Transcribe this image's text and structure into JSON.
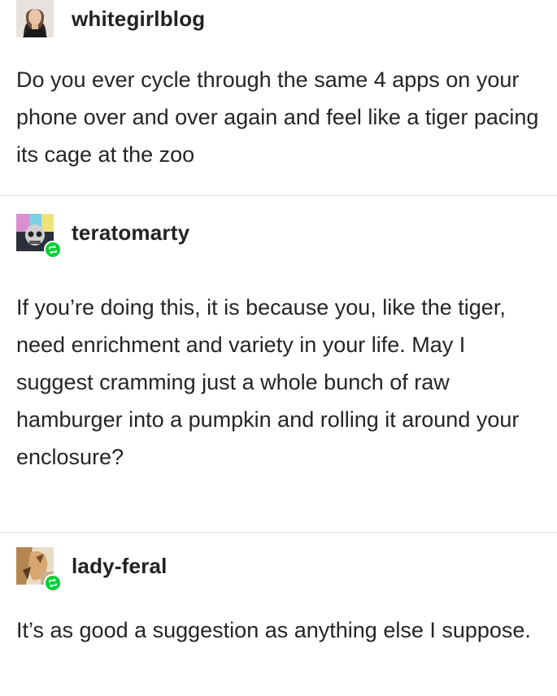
{
  "posts": [
    {
      "username": "whitegirlblog",
      "avatar_icon": "user-avatar-icon",
      "is_reblog": false,
      "text": "Do you ever cycle through the same 4 apps on your phone over and over again and feel like a tiger pacing its cage at the zoo"
    },
    {
      "username": "teratomarty",
      "avatar_icon": "user-avatar-icon",
      "is_reblog": true,
      "text": "If you’re doing this, it is because you, like the tiger, need enrichment and variety in your life. May I suggest cramming just a whole bunch of raw hamburger into a pumpkin and rolling it around your enclosure?"
    },
    {
      "username": "lady-feral",
      "avatar_icon": "user-avatar-icon",
      "is_reblog": true,
      "text": "It’s as good a suggestion as anything else I suppose."
    }
  ],
  "colors": {
    "reblog_badge": "#00cf35",
    "divider": "#dedede",
    "text": "#252525"
  }
}
